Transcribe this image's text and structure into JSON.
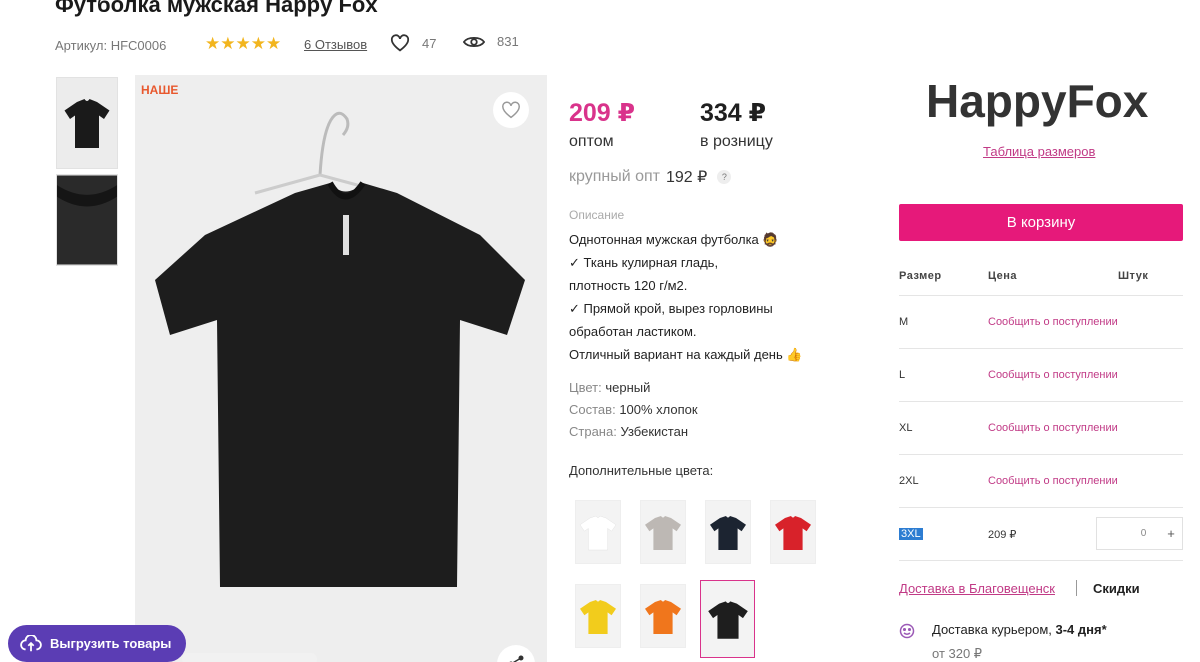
{
  "product": {
    "title": "Футболка мужская Happy Fox",
    "article": "Артикул: НFC0006",
    "rating_stars": 5,
    "reviews": "6 Отзывов",
    "likes": "47",
    "views": "831",
    "badge": "НАШЕ"
  },
  "pricing": {
    "wholesale": "209 ₽",
    "wholesale_label": "оптом",
    "retail": "334 ₽",
    "retail_label": "в розницу",
    "bulk_label": "крупный опт",
    "bulk_price": "192 ₽",
    "bulk_help": "?"
  },
  "description": {
    "heading": "Описание",
    "lines": [
      "Однотонная мужская футболка 🧔",
      "✓ Ткань кулирная гладь,",
      "плотность 120 г/м2.",
      "✓ Прямой крой, вырез горловины",
      "обработан ластиком.",
      "Отличный вариант на каждый день 👍"
    ]
  },
  "properties": [
    {
      "key": "Цвет:",
      "value": "черный"
    },
    {
      "key": "Состав:",
      "value": "100% хлопок"
    },
    {
      "key": "Страна:",
      "value": "Узбекистан"
    }
  ],
  "extra_colors": {
    "heading": "Дополнительные цвета:",
    "colors": [
      "#f7f7f7",
      "#bdb8b4",
      "#1c2431",
      "#d8222a",
      "#f2cc1c",
      "#f0761c",
      "#1e1e1e"
    ]
  },
  "brand": {
    "logo": "HappyFox",
    "size_table": "Таблица размеров"
  },
  "cart": {
    "button": "В корзину",
    "columns": [
      "Размер",
      "Цена",
      "Штук"
    ],
    "rows": [
      {
        "size": "M",
        "status": "Сообщить о поступлении"
      },
      {
        "size": "L",
        "status": "Сообщить о поступлении"
      },
      {
        "size": "XL",
        "status": "Сообщить о поступлении"
      },
      {
        "size": "2XL",
        "status": "Сообщить о поступлении"
      },
      {
        "size": "3XL",
        "price": "209 ₽",
        "qty": "0",
        "plus": "+"
      }
    ]
  },
  "delivery": {
    "link": "Доставка в Благовещенск",
    "discounts": "Скидки",
    "courier": "Доставка курьером,",
    "courier_days": "3-4 дня*",
    "courier_price": "от 320 ₽"
  },
  "export": {
    "label": "Выгрузить товары"
  },
  "colors": {
    "accent": "#e6197a",
    "price": "#d9338b",
    "link": "#c13a86",
    "export_button": "#5b3db4",
    "star": "#f2b51e"
  }
}
